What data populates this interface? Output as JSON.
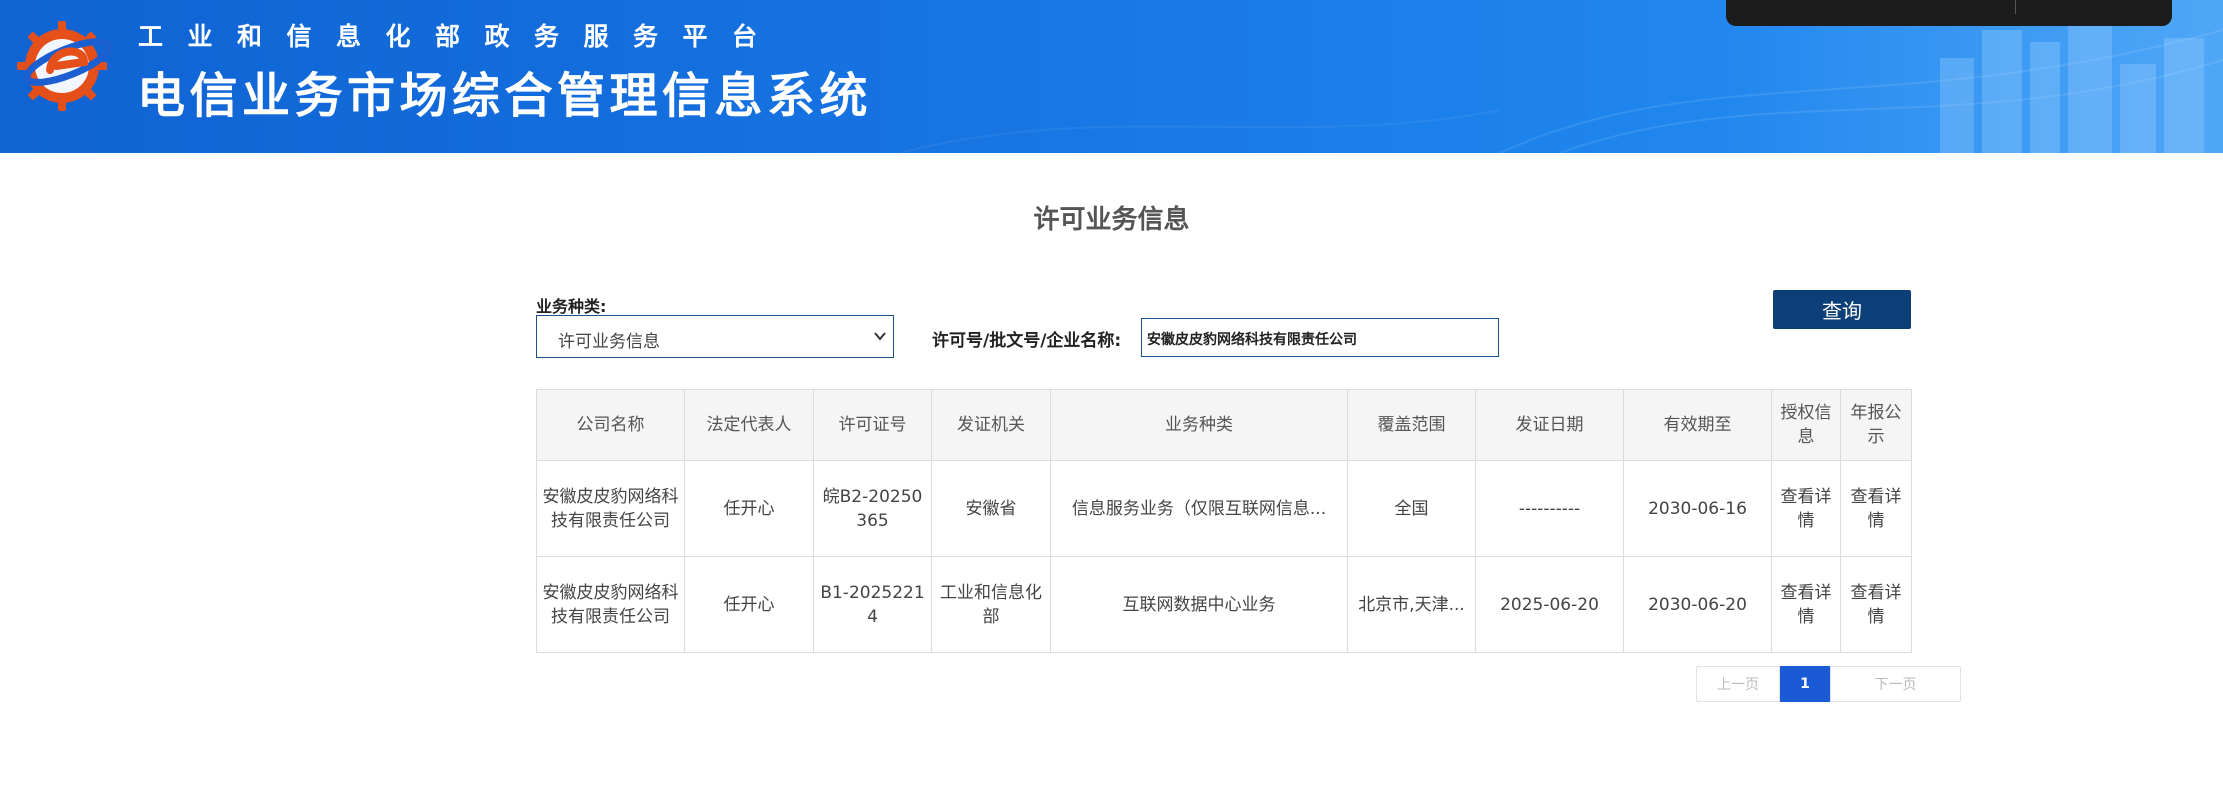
{
  "header": {
    "platform_name": "工业和信息化部政务服务平台",
    "system_name": "电信业务市场综合管理信息系统",
    "logo_icon": "ministry-gear-logo-icon",
    "colors": {
      "banner": "#1570e0",
      "logo_gear": "#e5501a"
    }
  },
  "page": {
    "title": "许可业务信息"
  },
  "filters": {
    "type_label": "业务种类:",
    "type_value": "许可业务信息",
    "search_label": "许可号/批文号/企业名称:",
    "search_value": "安徽皮皮豹网络科技有限责任公司",
    "query_button": "查询",
    "button_color": "#0c3e78"
  },
  "table": {
    "headers": [
      "公司名称",
      "法定代表人",
      "许可证号",
      "发证机关",
      "业务种类",
      "覆盖范围",
      "发证日期",
      "有效期至",
      "授权信息",
      "年报公示"
    ],
    "rows": [
      {
        "company": "安徽皮皮豹网络科技有限责任公司",
        "legal_rep": "任开心",
        "license_no": "皖B2-20250365",
        "issuer": "安徽省",
        "business_type": "信息服务业务（仅限互联网信息...",
        "coverage": "全国",
        "issue_date": "----------",
        "valid_until": "2030-06-16",
        "auth_link": "查看详情",
        "report_link": "查看详情"
      },
      {
        "company": "安徽皮皮豹网络科技有限责任公司",
        "legal_rep": "任开心",
        "license_no": "B1-20252214",
        "issuer": "工业和信息化部",
        "business_type": "互联网数据中心业务",
        "coverage": "北京市,天津...",
        "issue_date": "2025-06-20",
        "valid_until": "2030-06-20",
        "auth_link": "查看详情",
        "report_link": "查看详情"
      }
    ]
  },
  "pagination": {
    "prev": "上一页",
    "current": "1",
    "next": "下一页",
    "active_color": "#1a5ad7"
  }
}
